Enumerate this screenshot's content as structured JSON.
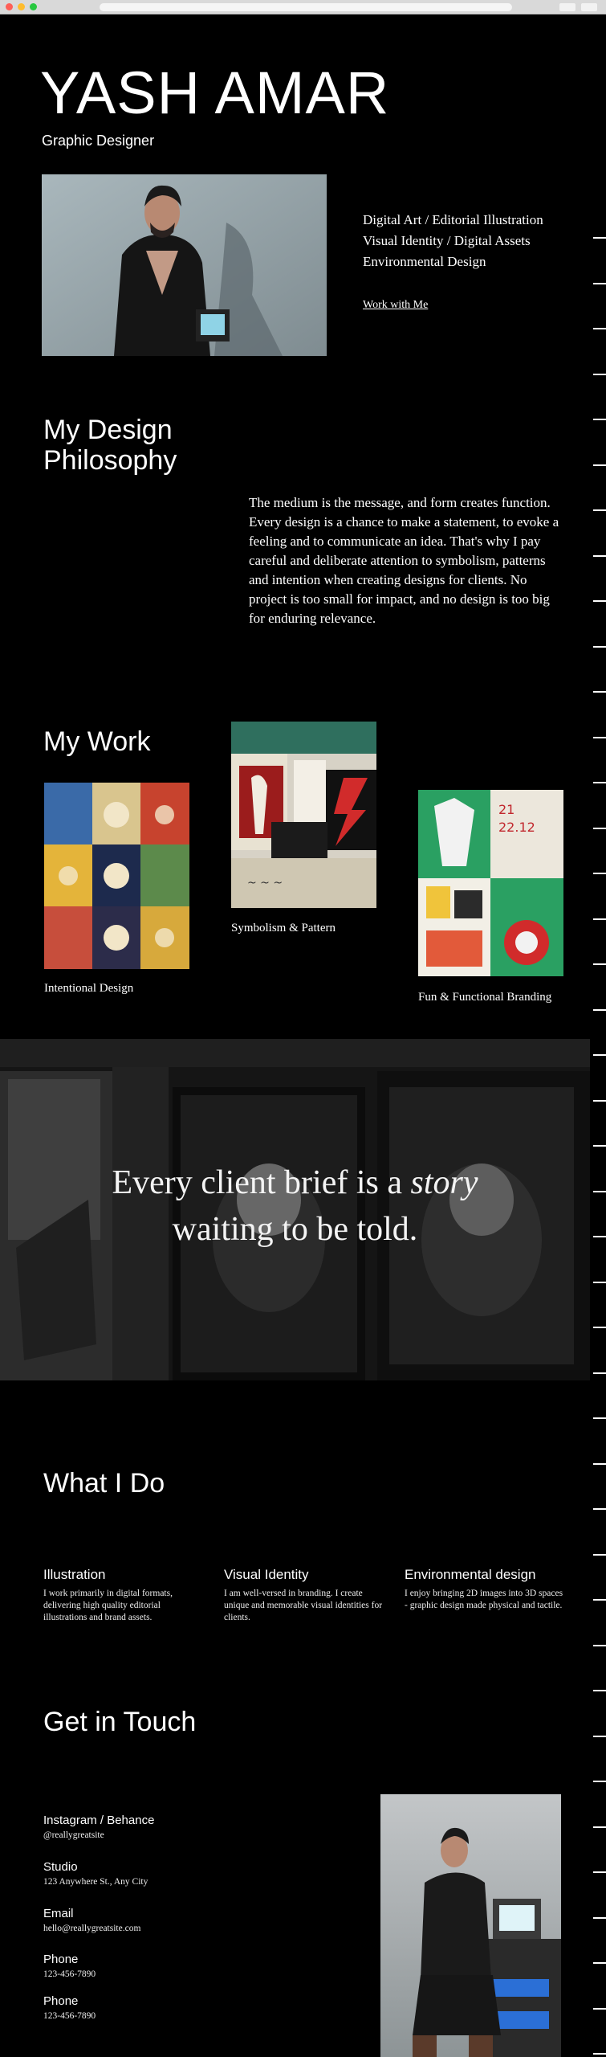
{
  "hero": {
    "name": "YASH AMAR",
    "subtitle": "Graphic Designer",
    "services": [
      "Digital Art / Editorial Illustration",
      "Visual Identity / Digital Assets",
      "Environmental Design"
    ],
    "cta": "Work with Me"
  },
  "philosophy": {
    "title": "My Design Philosophy",
    "body": "The medium is the message, and form creates function. Every design is a chance to make a statement, to evoke a feeling and to communicate an idea. That's why I pay careful and deliberate attention to symbolism, patterns and intention when creating designs for clients. No project is too small for impact, and no design is too big for enduring relevance."
  },
  "work": {
    "title": "My Work",
    "items": [
      {
        "caption": "Intentional Design"
      },
      {
        "caption": "Symbolism & Pattern"
      },
      {
        "caption": "Fun & Functional Branding"
      }
    ]
  },
  "banner": {
    "quote_part1": "Every client brief is a ",
    "quote_italic": "story",
    "quote_part2": "waiting to be told."
  },
  "what_i_do": {
    "title": "What I Do",
    "items": [
      {
        "title": "Illustration",
        "desc": "I work primarily in digital formats, delivering high quality editorial illustrations and brand assets."
      },
      {
        "title": "Visual Identity",
        "desc": "I am well-versed in branding. I create unique and memorable visual identities for clients."
      },
      {
        "title": "Environmental design",
        "desc": "I enjoy bringing 2D images into 3D spaces - graphic design made physical and tactile."
      }
    ]
  },
  "contact": {
    "title": "Get in Touch",
    "items": [
      {
        "label": "Instagram / Behance",
        "value": "@reallygreatsite"
      },
      {
        "label": "Studio",
        "value": "123 Anywhere St., Any City"
      },
      {
        "label": "Email",
        "value": "hello@reallygreatsite.com"
      },
      {
        "label": "Phone",
        "value": "123-456-7890"
      },
      {
        "label": "Phone",
        "value": "123-456-7890"
      }
    ]
  },
  "colors": {
    "background": "#000000",
    "text": "#ffffff"
  }
}
